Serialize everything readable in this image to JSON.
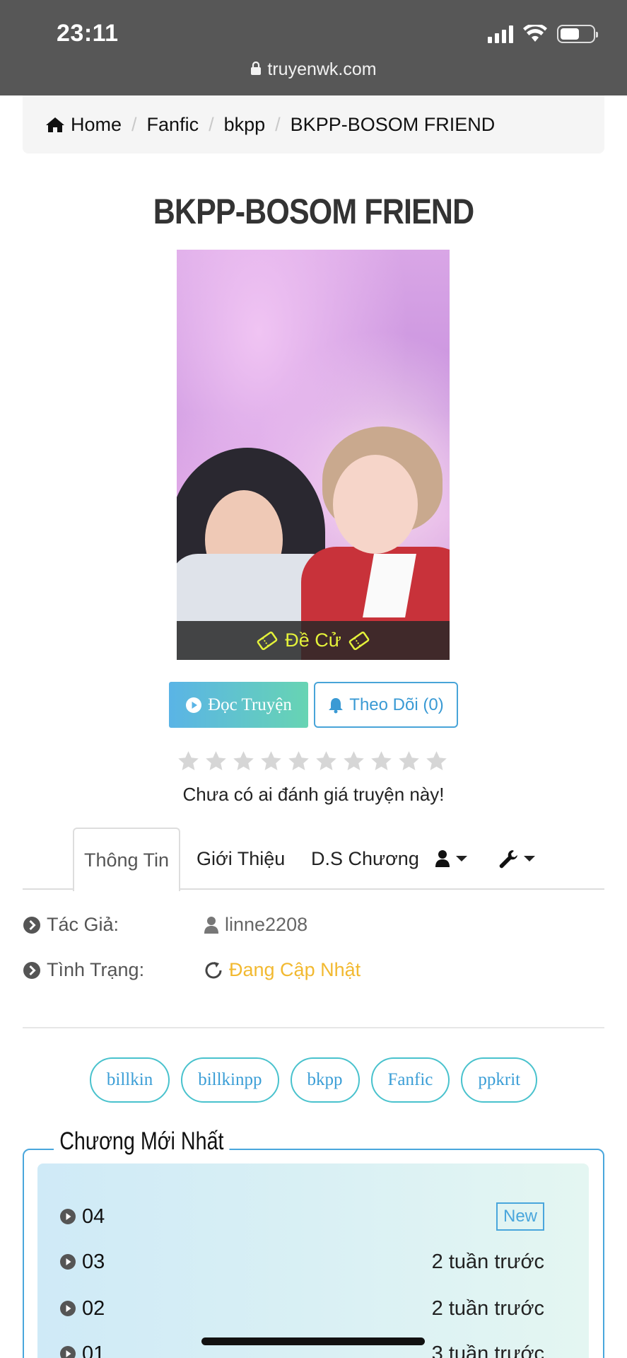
{
  "status_bar": {
    "time": "23:11",
    "url": "truyenwk.com"
  },
  "breadcrumb": {
    "home": "Home",
    "items": [
      "Fanfic",
      "bkpp",
      "BKPP-BOSOM FRIEND"
    ]
  },
  "story": {
    "title": "BKPP-BOSOM FRIEND",
    "cover_badge": "Đề Cử",
    "read_button": "Đọc Truyện",
    "follow_button": "Theo Dõi (0)",
    "rating": {
      "stars_filled": 0,
      "stars_total": 10,
      "message": "Chưa có ai đánh giá truyện này!"
    }
  },
  "tabs": {
    "info": "Thông Tin",
    "intro": "Giới Thiệu",
    "chapters": "D.S Chương"
  },
  "info": {
    "author_label": "Tác Giả:",
    "author_value": "linne2208",
    "status_label": "Tình Trạng:",
    "status_value": "Đang Cập Nhật",
    "status_color": "#f2b930"
  },
  "tags": [
    "billkin",
    "billkinpp",
    "bkpp",
    "Fanfic",
    "ppkrit"
  ],
  "latest": {
    "heading": "Chương Mới Nhất",
    "chapters": [
      {
        "name": "04",
        "time": "New",
        "is_new": true
      },
      {
        "name": "03",
        "time": "2 tuần trước"
      },
      {
        "name": "02",
        "time": "2 tuần trước"
      },
      {
        "name": "01",
        "time": "3 tuần trước"
      }
    ]
  },
  "colors": {
    "accent": "#49a6dc",
    "tag_border": "#49c2cd",
    "badge_text": "#e4f23a"
  }
}
